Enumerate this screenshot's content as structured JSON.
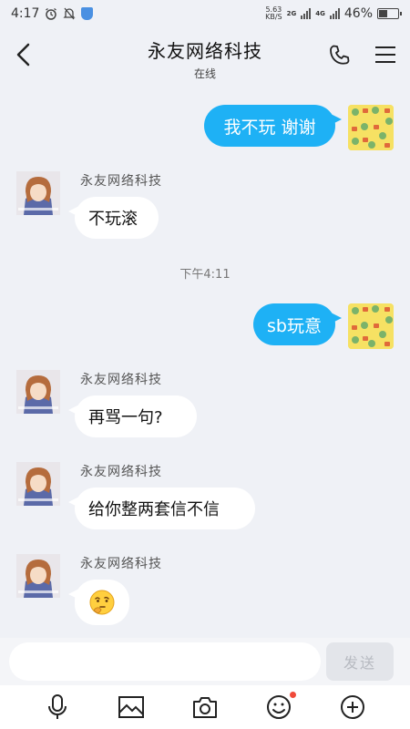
{
  "status_bar": {
    "time": "4:17",
    "net_speed_value": "5.63",
    "net_speed_unit": "KB/S",
    "signal1_tag": "2G",
    "signal2_tag": "4G",
    "battery": "46%",
    "battery_level": 0.46
  },
  "header": {
    "title": "永友网络科技",
    "subtitle": "在线"
  },
  "messages": [
    {
      "direction": "out",
      "text": "我不玩 谢谢"
    },
    {
      "direction": "in",
      "sender": "永友网络科技",
      "text": "不玩滚"
    },
    {
      "type": "timestamp",
      "text": "下午4:11"
    },
    {
      "direction": "out",
      "text": "sb玩意"
    },
    {
      "direction": "in",
      "sender": "永友网络科技",
      "text": "再骂一句?"
    },
    {
      "direction": "in",
      "sender": "永友网络科技",
      "text": "给你整两套信不信"
    },
    {
      "direction": "in",
      "sender": "永友网络科技",
      "text": "",
      "emoji": "thinking-face"
    }
  ],
  "input": {
    "value": "",
    "placeholder": "",
    "send_label": "发送"
  },
  "toolbar": {
    "icons": [
      "microphone-icon",
      "image-icon",
      "camera-icon",
      "emoji-icon",
      "plus-icon"
    ]
  },
  "colors": {
    "outgoing_bubble": "#1eb1f5",
    "incoming_bubble": "#ffffff",
    "background": "#eff1f6",
    "notification_dot": "#f04a3a"
  }
}
